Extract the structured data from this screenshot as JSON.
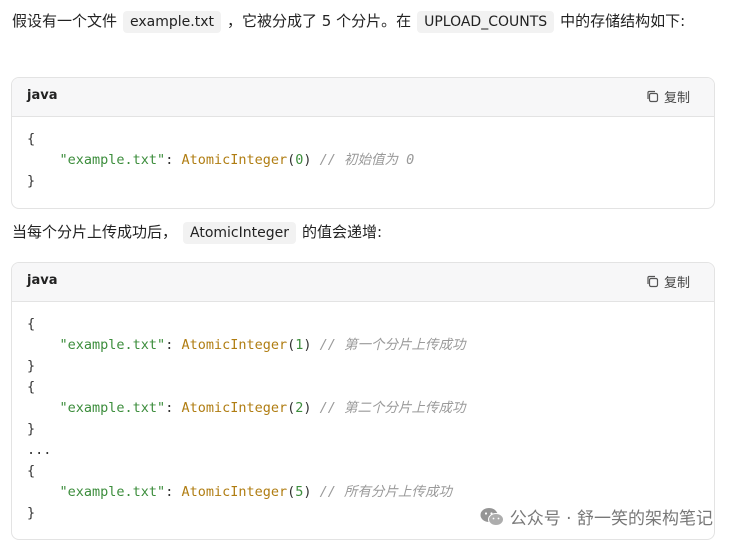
{
  "intro": {
    "text_before": "假设有一个文件",
    "file_name": "example.txt",
    "text_mid": "，它被分成了 5 个分片。在",
    "map_name": "UPLOAD_COUNTS",
    "text_after": "中的存储结构如下:"
  },
  "block1": {
    "lang": "java",
    "copy_label": "复制",
    "lines": [
      {
        "indent": "",
        "open": "{"
      },
      {
        "indent": "    ",
        "key": "\"example.txt\"",
        "colon": ": ",
        "cls": "AtomicInteger",
        "lp": "(",
        "num": "0",
        "rp": ")",
        "comment": " // 初始值为 0"
      },
      {
        "indent": "",
        "open": "}"
      }
    ]
  },
  "middle": {
    "text_before": "当每个分片上传成功后，",
    "class_name": "AtomicInteger",
    "text_after": "的值会递增:"
  },
  "block2": {
    "lang": "java",
    "copy_label": "复制",
    "lines": [
      {
        "indent": "",
        "open": "{"
      },
      {
        "indent": "    ",
        "key": "\"example.txt\"",
        "colon": ": ",
        "cls": "AtomicInteger",
        "lp": "(",
        "num": "1",
        "rp": ")",
        "comment": " // 第一个分片上传成功"
      },
      {
        "indent": "",
        "open": "}"
      },
      {
        "indent": "",
        "open": "{"
      },
      {
        "indent": "    ",
        "key": "\"example.txt\"",
        "colon": ": ",
        "cls": "AtomicInteger",
        "lp": "(",
        "num": "2",
        "rp": ")",
        "comment": " // 第二个分片上传成功"
      },
      {
        "indent": "",
        "open": "}"
      },
      {
        "indent": "",
        "open": "..."
      },
      {
        "indent": "",
        "open": "{"
      },
      {
        "indent": "    ",
        "key": "\"example.txt\"",
        "colon": ": ",
        "cls": "AtomicInteger",
        "lp": "(",
        "num": "5",
        "rp": ")",
        "comment": " // 所有分片上传成功"
      },
      {
        "indent": "",
        "open": "}"
      }
    ]
  },
  "watermark": {
    "text": "公众号 · 舒一笑的架构笔记"
  },
  "colors": {
    "string": "#3c8d3c",
    "class": "#b07d12",
    "comment": "#9a9a9a",
    "inline_code_bg": "#f2f2f2",
    "code_header_bg": "#f7f7f8"
  }
}
